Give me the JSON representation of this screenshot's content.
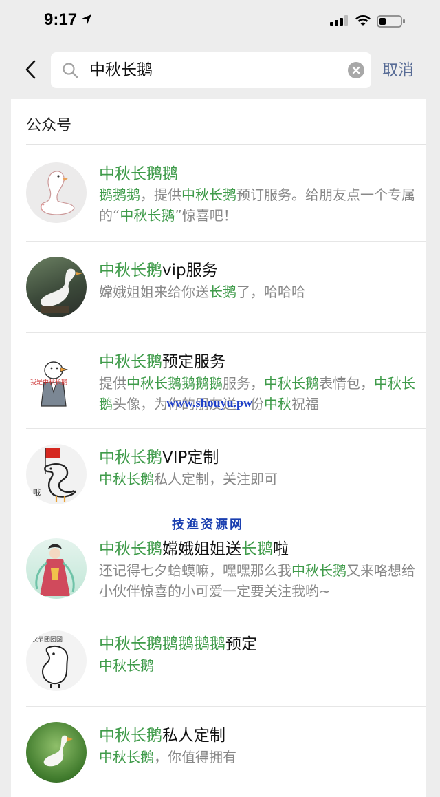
{
  "status_bar": {
    "time": "9:17"
  },
  "search": {
    "query": "中秋长鹅",
    "cancel_label": "取消"
  },
  "section": {
    "title": "公众号"
  },
  "results": [
    {
      "title": [
        {
          "t": "中秋长鹅鹅",
          "h": true
        }
      ],
      "desc": [
        {
          "t": "鹅鹅鹅",
          "h": true
        },
        {
          "t": "，提供"
        },
        {
          "t": "中秋长鹅",
          "h": true
        },
        {
          "t": "预订服务。给朋友点一个专属的“"
        },
        {
          "t": "中秋长鹅",
          "h": true
        },
        {
          "t": "”惊喜吧！"
        }
      ],
      "avatar": "white-goose-drawing"
    },
    {
      "title": [
        {
          "t": "中秋长鹅",
          "h": true
        },
        {
          "t": "vip服务"
        }
      ],
      "desc": [
        {
          "t": "嫦娥姐姐来给你送"
        },
        {
          "t": "长鹅",
          "h": true
        },
        {
          "t": "了，哈哈哈"
        }
      ],
      "avatar": "goose-photo"
    },
    {
      "title": [
        {
          "t": "中秋长鹅",
          "h": true
        },
        {
          "t": "预定服务"
        }
      ],
      "desc": [
        {
          "t": "提供"
        },
        {
          "t": "中秋长鹅鹅鹅鹅",
          "h": true
        },
        {
          "t": "服务，"
        },
        {
          "t": "中秋长鹅",
          "h": true
        },
        {
          "t": "表情包，"
        },
        {
          "t": "中秋长鹅",
          "h": true
        },
        {
          "t": "头像，为你的朋友送一份"
        },
        {
          "t": "中秋",
          "h": true
        },
        {
          "t": "祝福"
        }
      ],
      "avatar": "goose-in-suit-drawing",
      "avatar_text": "我是中秋长鹅"
    },
    {
      "title": [
        {
          "t": "中秋长鹅",
          "h": true
        },
        {
          "t": "VIP定制"
        }
      ],
      "desc": [
        {
          "t": "中秋长鹅",
          "h": true
        },
        {
          "t": "私人定制，关注即可"
        }
      ],
      "avatar": "goose-flag-drawing",
      "avatar_text": "哦"
    },
    {
      "title": [
        {
          "t": "中秋长鹅",
          "h": true
        },
        {
          "t": "嫦娥姐姐送"
        },
        {
          "t": "长鹅",
          "h": true
        },
        {
          "t": "啦"
        }
      ],
      "desc": [
        {
          "t": "还记得七夕蛤蟆嘛，嘿嘿那么我"
        },
        {
          "t": "中秋长鹅",
          "h": true
        },
        {
          "t": "又来咯想给小伙伴惊喜的小可爱一定要关注我哟~"
        }
      ],
      "avatar": "change-fairy-drawing"
    },
    {
      "title": [
        {
          "t": "中秋长鹅鹅鹅鹅鹅",
          "h": true
        },
        {
          "t": "预定"
        }
      ],
      "desc": [
        {
          "t": "中秋长鹅",
          "h": true
        }
      ],
      "avatar": "goose-sketch",
      "avatar_text": "秋节团团圆"
    },
    {
      "title": [
        {
          "t": "中秋长鹅",
          "h": true
        },
        {
          "t": "私人定制"
        }
      ],
      "desc": [
        {
          "t": "中秋长鹅",
          "h": true
        },
        {
          "t": "，你值得拥有"
        }
      ],
      "avatar": "goose-grass-photo"
    }
  ],
  "watermark": {
    "text": "技渔资源网",
    "url": "www.shouyu.pw"
  },
  "colors": {
    "highlight": "#3f9b4a",
    "link": "#576b95",
    "background": "#ededed"
  }
}
